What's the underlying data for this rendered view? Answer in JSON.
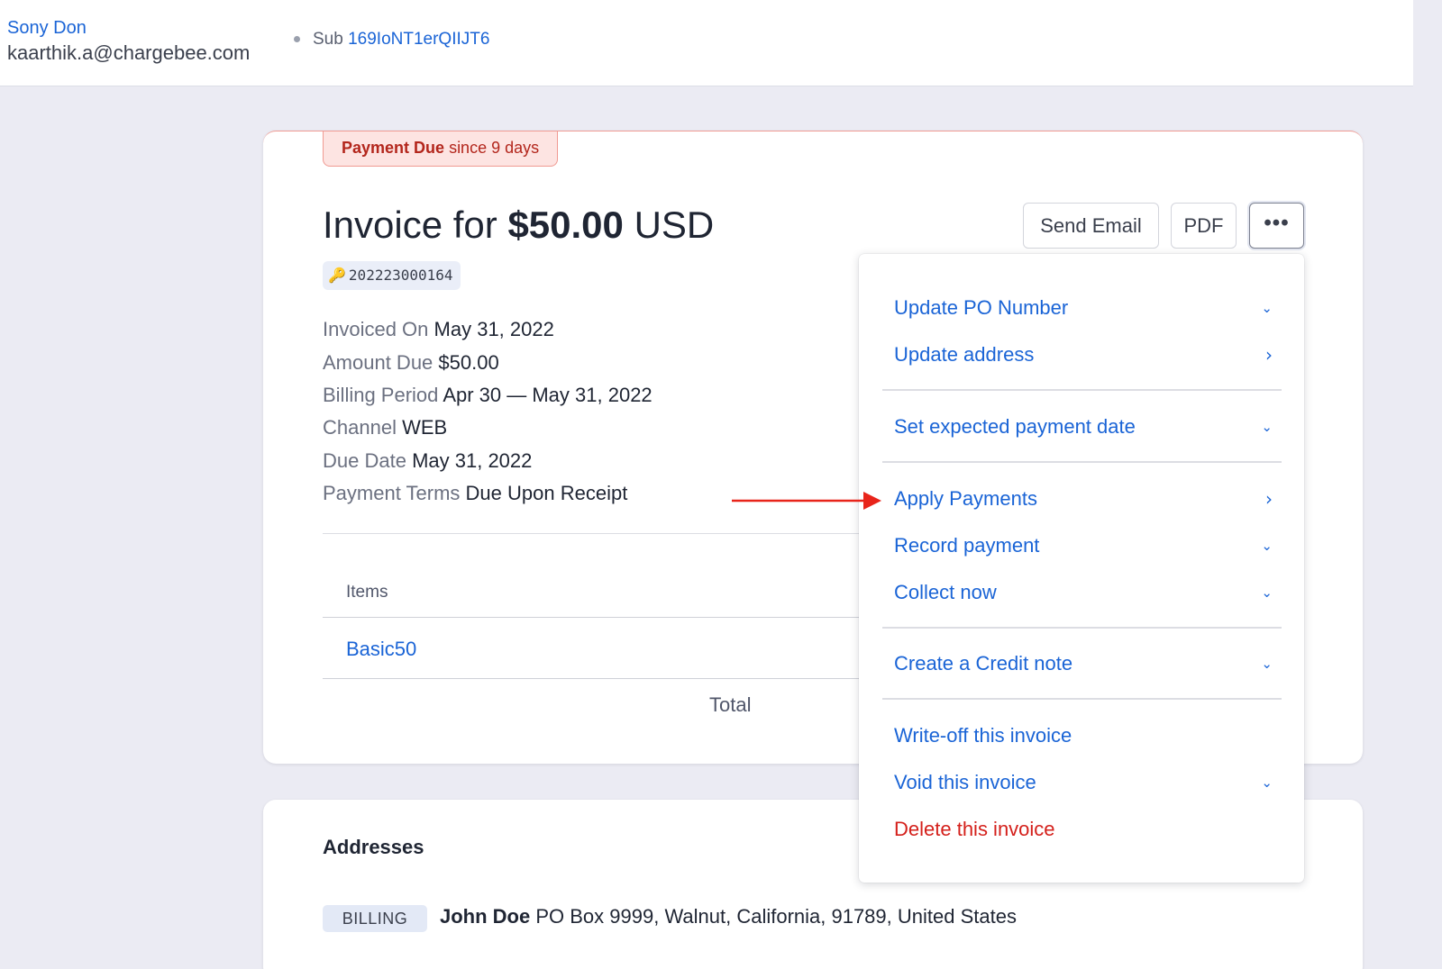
{
  "header": {
    "customer_name": "Sony Don",
    "customer_email": "kaarthik.a@chargebee.com",
    "sub_label": "Sub",
    "sub_id": "169IoNT1erQIIJT6"
  },
  "invoice": {
    "status": "Payment Due",
    "status_since": "since 9 days",
    "title_prefix": "Invoice for",
    "amount": "$50.00",
    "currency": "USD",
    "number": "202223000164",
    "meta": [
      {
        "label": "Invoiced On",
        "value": "May 31, 2022"
      },
      {
        "label": "Amount Due",
        "value": "$50.00"
      },
      {
        "label": "Billing Period",
        "value": "Apr 30 — May 31, 2022"
      },
      {
        "label": "Channel",
        "value": "WEB"
      },
      {
        "label": "Due Date",
        "value": "May 31, 2022"
      },
      {
        "label": "Payment Terms",
        "value": "Due Upon Receipt"
      }
    ],
    "items_header": "Items",
    "items": [
      {
        "name": "Basic50"
      }
    ],
    "total_label": "Total"
  },
  "actions": {
    "send_email": "Send Email",
    "pdf": "PDF",
    "more": "•••"
  },
  "menu": {
    "items": [
      {
        "label": "Update PO Number",
        "chevron": "⌄"
      },
      {
        "label": "Update address",
        "chevron": "›"
      },
      {
        "label": "Set expected payment date",
        "chevron": "⌄"
      },
      {
        "label": "Apply Payments",
        "chevron": "›"
      },
      {
        "label": "Record payment",
        "chevron": "⌄"
      },
      {
        "label": "Collect now",
        "chevron": "⌄"
      },
      {
        "label": "Create a Credit note",
        "chevron": "⌄"
      },
      {
        "label": "Write-off this invoice",
        "chevron": ""
      },
      {
        "label": "Void this invoice",
        "chevron": "⌄"
      },
      {
        "label": "Delete this invoice",
        "chevron": ""
      }
    ]
  },
  "addresses": {
    "title": "Addresses",
    "billing_badge": "BILLING",
    "billing_name": "John Doe",
    "billing_address": "PO Box 9999, Walnut, California, 91789, United States"
  },
  "colors": {
    "link": "#1a64d6",
    "danger": "#d4201b",
    "annotation_arrow": "#e8241a",
    "due_badge_bg": "#fde4e2"
  }
}
